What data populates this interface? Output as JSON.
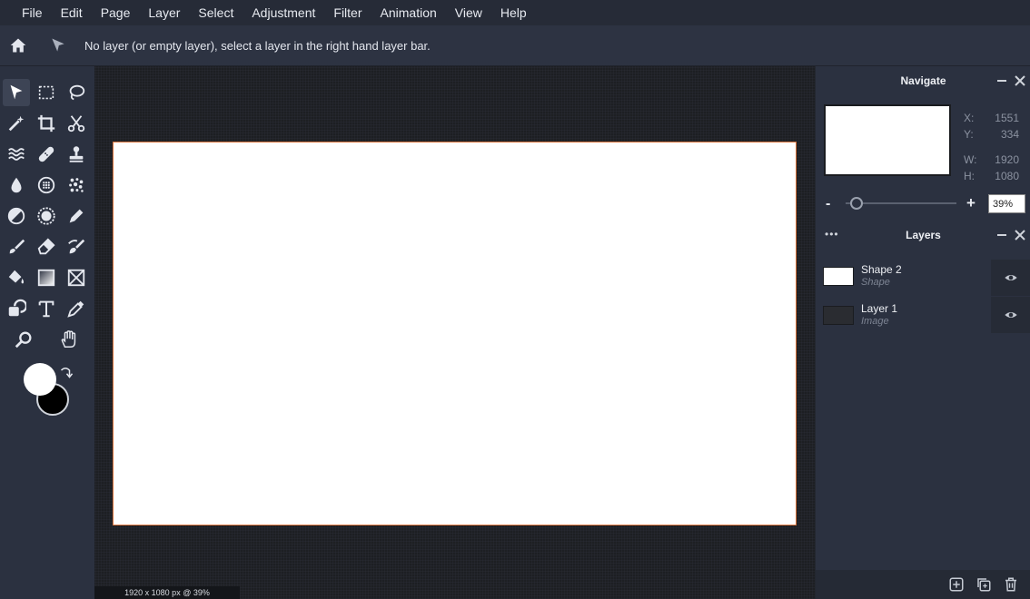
{
  "menubar": {
    "items": [
      "File",
      "Edit",
      "Page",
      "Layer",
      "Select",
      "Adjustment",
      "Filter",
      "Animation",
      "View",
      "Help"
    ]
  },
  "options": {
    "message": "No layer (or empty layer), select a layer in the right hand layer bar."
  },
  "toolbar": {
    "active_tool": "move-tool",
    "tools": [
      "move",
      "rect-select",
      "lasso",
      "magic-wand",
      "crop",
      "cut",
      "liquify",
      "heal",
      "stamp",
      "blur",
      "sponge",
      "spray",
      "dodge",
      "burn",
      "pen",
      "brush",
      "eraser",
      "smudge",
      "fill",
      "gradient",
      "shape",
      "clone",
      "text",
      "eyedropper",
      "zoom",
      "hand"
    ],
    "foreground_color": "#ffffff",
    "background_color": "#000000"
  },
  "canvas": {
    "background": "#ffffff",
    "border_color": "#d9743c",
    "size_label": "1920 x 1080 px @ 39%"
  },
  "navigate": {
    "title": "Navigate",
    "x_label": "X:",
    "x_value": "1551",
    "y_label": "Y:",
    "y_value": "334",
    "w_label": "W:",
    "w_value": "1920",
    "h_label": "H:",
    "h_value": "1080",
    "zoom_minus": "-",
    "zoom_plus": "+",
    "zoom_value": "39%",
    "zoom_fraction": 0.1
  },
  "layers": {
    "title": "Layers",
    "menu_dots": "•••",
    "items": [
      {
        "name": "Shape 2",
        "type": "Shape",
        "thumb": "#ffffff"
      },
      {
        "name": "Layer 1",
        "type": "Image",
        "thumb": "#2a2c31"
      }
    ]
  },
  "colors": {
    "accent": "#d9743c",
    "panel": "#2b3140",
    "menubar": "#262b37",
    "canvas_bg": "#1d1f23"
  }
}
